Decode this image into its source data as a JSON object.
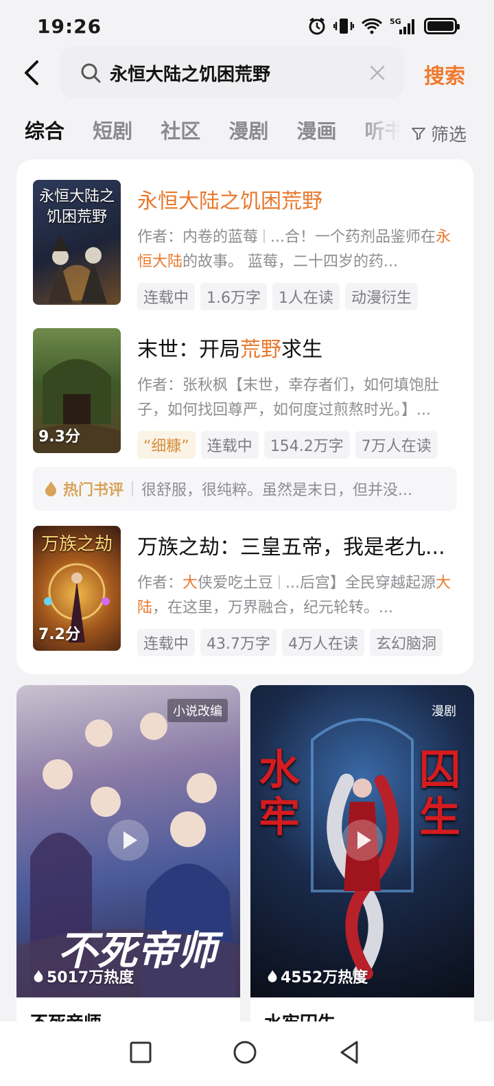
{
  "status_bar": {
    "time": "19:26",
    "network": "5G"
  },
  "search": {
    "query": "永恒大陆之饥困荒野",
    "button_label": "搜索"
  },
  "tabs": [
    {
      "label": "综合",
      "active": true
    },
    {
      "label": "短剧",
      "active": false
    },
    {
      "label": "社区",
      "active": false
    },
    {
      "label": "漫剧",
      "active": false
    },
    {
      "label": "漫画",
      "active": false
    },
    {
      "label": "听书",
      "active": false
    }
  ],
  "filter_label": "筛选",
  "results": [
    {
      "cover_text": "永恒大陆之饥困荒野",
      "title_parts": [
        {
          "text": "永恒大陆之饥困荒野",
          "hl": true
        }
      ],
      "author_label": "作者：",
      "author_parts": [
        {
          "text": "内卷的蓝莓",
          "hl": false
        }
      ],
      "desc_parts": [
        {
          "text": "...合！一个药剂品鉴师在",
          "hl": false
        },
        {
          "text": "永恒大陆",
          "hl": true
        },
        {
          "text": "的故事。 蓝莓，二十四岁的药...",
          "hl": false
        }
      ],
      "score": "",
      "tags": [
        {
          "text": "连载中"
        },
        {
          "text": "1.6万字"
        },
        {
          "text": "1人在读"
        },
        {
          "text": "动漫衍生"
        }
      ]
    },
    {
      "cover_text": "",
      "title_parts": [
        {
          "text": "末世：开局",
          "hl": false
        },
        {
          "text": "荒野",
          "hl": true
        },
        {
          "text": "求生",
          "hl": false
        }
      ],
      "author_label": "作者：",
      "author_parts": [
        {
          "text": "张秋枫",
          "hl": false
        }
      ],
      "desc_parts": [
        {
          "text": "【末世，幸存者们，如何填饱肚子，如何找回尊严，如何度过煎熬时光。】...",
          "hl": false
        }
      ],
      "score": "9.3分",
      "tags": [
        {
          "text": "“细糠”",
          "warm": true
        },
        {
          "text": "连载中"
        },
        {
          "text": "154.2万字"
        },
        {
          "text": "7万人在读"
        }
      ]
    },
    {
      "cover_text": "万族之劫",
      "title_parts": [
        {
          "text": "万族之劫：三皇五帝，我是老九...",
          "hl": false
        }
      ],
      "author_label": "作者：",
      "author_parts": [
        {
          "text": "大",
          "hl": true
        },
        {
          "text": "侠爱吃土豆",
          "hl": false
        }
      ],
      "desc_parts": [
        {
          "text": "...后宫】全民穿越起源",
          "hl": false
        },
        {
          "text": "大陆",
          "hl": true
        },
        {
          "text": "，在这里，万界融合，纪元轮转。...",
          "hl": false
        }
      ],
      "score": "7.2分",
      "tags": [
        {
          "text": "连载中"
        },
        {
          "text": "43.7万字"
        },
        {
          "text": "4万人在读"
        },
        {
          "text": "玄幻脑洞"
        }
      ]
    }
  ],
  "hot_review": {
    "label": "热门书评",
    "text": "很舒服，很纯粹。虽然是末日，但并没..."
  },
  "dramas": [
    {
      "badge": "小说改编",
      "poster_title": "不死帝师",
      "heat": "5017万热度",
      "name": "不死帝师"
    },
    {
      "badge": "漫剧",
      "poster_title_left": "水牢",
      "poster_title_right": "囚生",
      "heat": "4552万热度",
      "name": "水牢囚生"
    }
  ],
  "colors": {
    "accent": "#e8792d",
    "search_button": "#ef7a2e"
  }
}
